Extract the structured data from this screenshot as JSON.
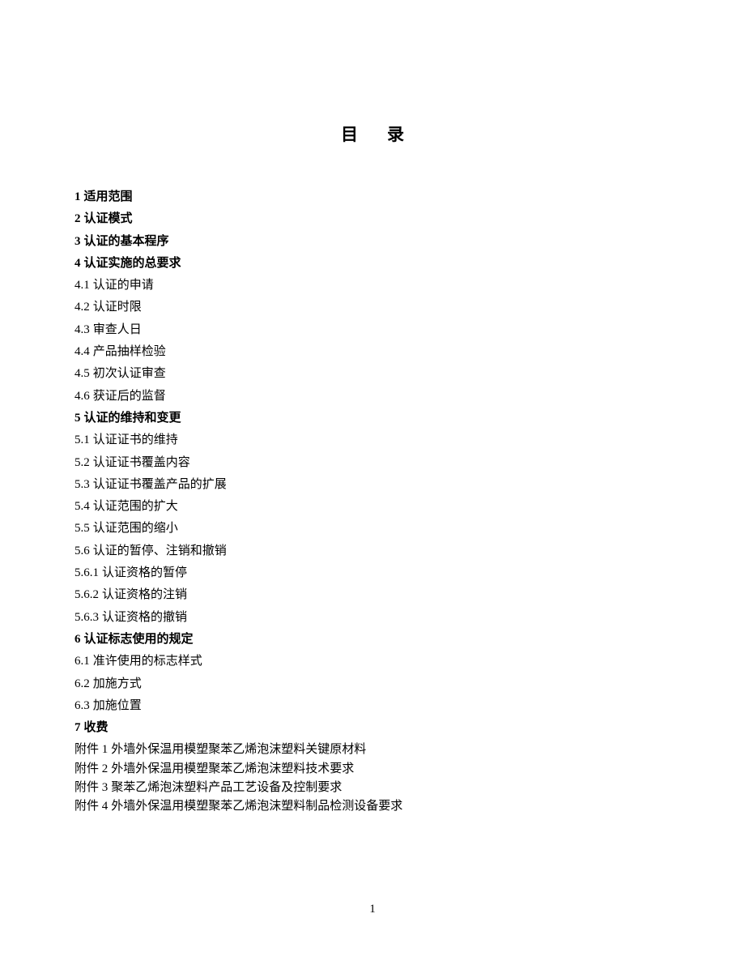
{
  "title": "目录",
  "toc": [
    {
      "num": "1",
      "text": "适用范围",
      "bold": true
    },
    {
      "num": "2",
      "text": "认证模式",
      "bold": true
    },
    {
      "num": "3",
      "text": "认证的基本程序",
      "bold": true
    },
    {
      "num": "4",
      "text": "认证实施的总要求",
      "bold": true
    },
    {
      "num": "4.1",
      "text": "认证的申请",
      "bold": false
    },
    {
      "num": "4.2",
      "text": "认证时限",
      "bold": false
    },
    {
      "num": "4.3",
      "text": "审查人日",
      "bold": false
    },
    {
      "num": "4.4",
      "text": "产品抽样检验",
      "bold": false
    },
    {
      "num": "4.5",
      "text": "初次认证审查",
      "bold": false
    },
    {
      "num": "4.6",
      "text": "获证后的监督",
      "bold": false
    },
    {
      "num": "5",
      "text": "认证的维持和变更",
      "bold": true
    },
    {
      "num": "5.1",
      "text": "认证证书的维持",
      "bold": false
    },
    {
      "num": "5.2",
      "text": "认证证书覆盖内容",
      "bold": false
    },
    {
      "num": "5.3",
      "text": "认证证书覆盖产品的扩展",
      "bold": false
    },
    {
      "num": "5.4",
      "text": "认证范围的扩大",
      "bold": false
    },
    {
      "num": "5.5",
      "text": "认证范围的缩小",
      "bold": false
    },
    {
      "num": "5.6",
      "text": "认证的暂停、注销和撤销",
      "bold": false
    },
    {
      "num": "5.6.1",
      "text": "认证资格的暂停",
      "bold": false
    },
    {
      "num": "5.6.2",
      "text": "认证资格的注销",
      "bold": false
    },
    {
      "num": "5.6.3",
      "text": "认证资格的撤销",
      "bold": false
    },
    {
      "num": "6",
      "text": "认证标志使用的规定",
      "bold": true
    },
    {
      "num": "6.1",
      "text": "准许使用的标志样式",
      "bold": false
    },
    {
      "num": "6.2",
      "text": "加施方式",
      "bold": false
    },
    {
      "num": "6.3",
      "text": "加施位置",
      "bold": false
    },
    {
      "num": "7",
      "text": "收费",
      "bold": true
    }
  ],
  "appendices": [
    {
      "num": "附件 1",
      "text": "外墙外保温用模塑聚苯乙烯泡沫塑料关键原材料"
    },
    {
      "num": "附件 2",
      "text": "外墙外保温用模塑聚苯乙烯泡沫塑料技术要求"
    },
    {
      "num": "附件 3",
      "text": "聚苯乙烯泡沫塑料产品工艺设备及控制要求"
    },
    {
      "num": "附件 4",
      "text": "外墙外保温用模塑聚苯乙烯泡沫塑料制品检测设备要求"
    }
  ],
  "page_number": "1"
}
